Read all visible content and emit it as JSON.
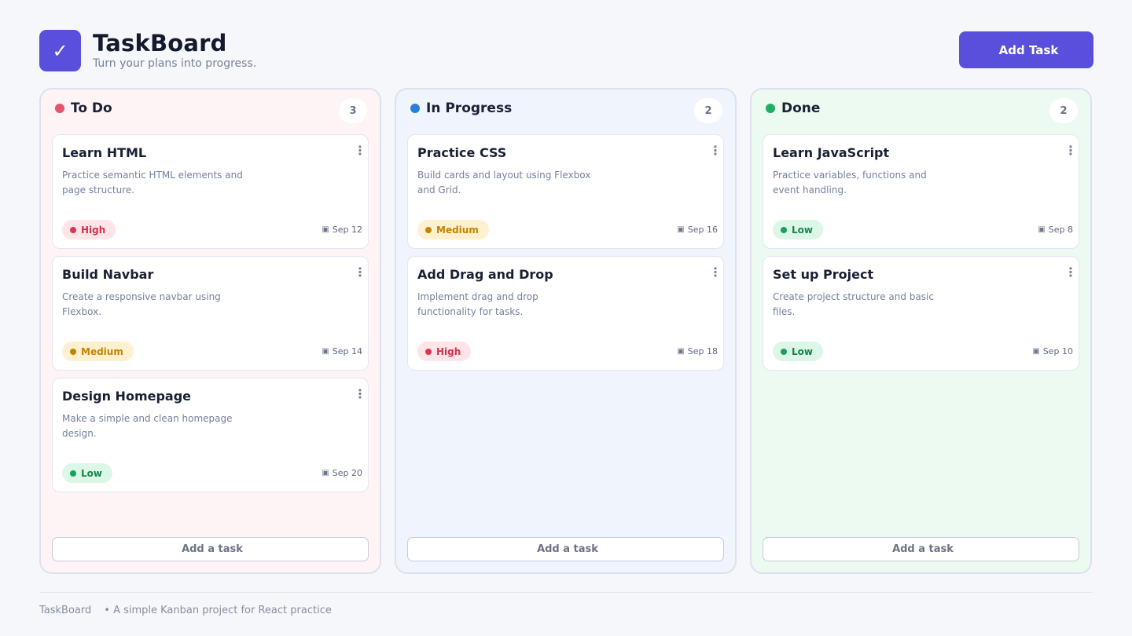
{
  "header": {
    "logo_glyph": "✓",
    "title": "TaskBoard",
    "subtitle": "Turn your plans into progress.",
    "add_task_icon": "",
    "add_task_label": "Add Task"
  },
  "columns": [
    {
      "title": "To Do",
      "count": "3",
      "dot_color": "#e5546a",
      "cards": [
        {
          "title": "Learn HTML",
          "desc": "Practice semantic HTML elements and page structure.",
          "priority": "High",
          "date": "Sep 12"
        },
        {
          "title": "Build Navbar",
          "desc": "Create a responsive navbar using Flexbox.",
          "priority": "Medium",
          "date": "Sep 14"
        },
        {
          "title": "Design Homepage",
          "desc": "Make a simple and clean homepage design.",
          "priority": "Low",
          "date": "Sep 20"
        }
      ],
      "add_icon": "",
      "add_label": "Add a task"
    },
    {
      "title": "In Progress",
      "count": "2",
      "dot_color": "#2d7ddd",
      "cards": [
        {
          "title": "Practice CSS",
          "desc": "Build cards and layout using Flexbox and Grid.",
          "priority": "Medium",
          "date": "Sep 16"
        },
        {
          "title": "Add Drag and Drop",
          "desc": "Implement drag and drop functionality for tasks.",
          "priority": "High",
          "date": "Sep 18"
        }
      ],
      "add_icon": "",
      "add_label": "Add a task"
    },
    {
      "title": "Done",
      "count": "2",
      "dot_color": "#22ad62",
      "cards": [
        {
          "title": "Learn JavaScript",
          "desc": "Practice variables, functions and event handling.",
          "priority": "Low",
          "date": "Sep 8"
        },
        {
          "title": "Set up Project",
          "desc": "Create project structure and basic files.",
          "priority": "Low",
          "date": "Sep 10"
        }
      ],
      "add_icon": "",
      "add_label": "Add a task"
    }
  ],
  "card_menu_glyph": "⋮",
  "calendar_icon": "▣",
  "footer": {
    "brand": "TaskBoard",
    "tagline": "• A simple Kanban project for React practice"
  }
}
